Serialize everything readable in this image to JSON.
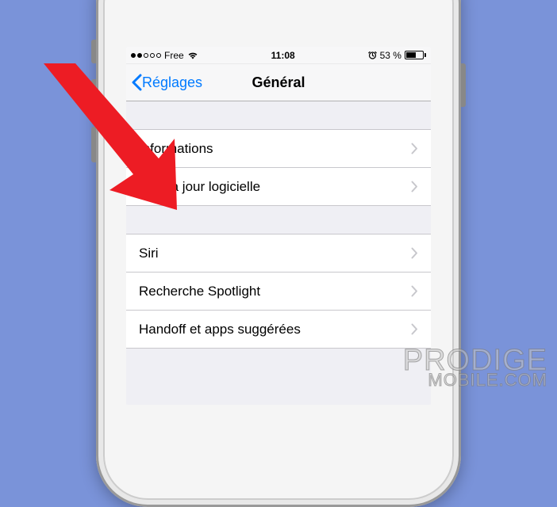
{
  "status_bar": {
    "carrier": "Free",
    "time": "11:08",
    "battery_percent": "53 %",
    "battery_fill_px": "12"
  },
  "nav": {
    "back_label": "Réglages",
    "title": "Général"
  },
  "groups": [
    {
      "rows": [
        {
          "label": "Informations"
        },
        {
          "label": "Mise à jour logicielle"
        }
      ]
    },
    {
      "rows": [
        {
          "label": "Siri"
        },
        {
          "label": "Recherche Spotlight"
        },
        {
          "label": "Handoff et apps suggérées"
        }
      ]
    }
  ],
  "watermark": {
    "line1": "PRODIGE",
    "line2": "MOBILE.COM"
  }
}
